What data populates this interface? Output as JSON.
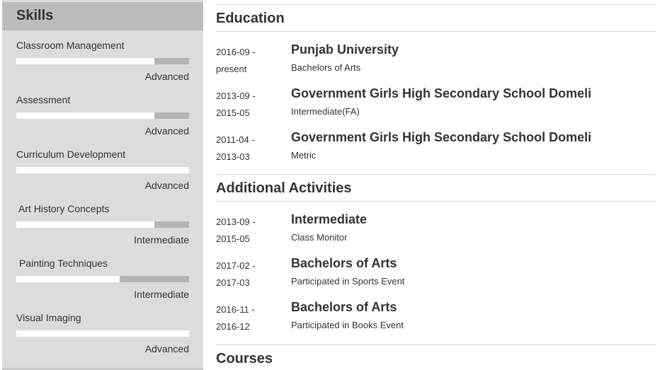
{
  "sidebar": {
    "title": "Skills",
    "skills": [
      {
        "name": "Classroom Management",
        "level": "Advanced",
        "fill": 0.8
      },
      {
        "name": "Assessment",
        "level": "Advanced",
        "fill": 0.8
      },
      {
        "name": "Curriculum Development",
        "level": "Advanced",
        "fill": 1.0
      },
      {
        "name": "Art History Concepts",
        "level": "Intermediate",
        "fill": 0.8
      },
      {
        "name": "Painting Techniques",
        "level": "Intermediate",
        "fill": 0.6
      },
      {
        "name": "Visual Imaging",
        "level": "Advanced",
        "fill": 1.0
      }
    ]
  },
  "education": {
    "title": "Education",
    "entries": [
      {
        "date_start": "2016-09 -",
        "date_end": "present",
        "title": "Punjab University",
        "subtitle": "Bachelors of Arts"
      },
      {
        "date_start": "2013-09 -",
        "date_end": "2015-05",
        "title": "Government Girls High Secondary School Domeli",
        "subtitle": "Intermediate(FA)"
      },
      {
        "date_start": "2011-04 -",
        "date_end": "2013-03",
        "title": "Government Girls High Secondary School Domeli",
        "subtitle": "Metric"
      }
    ]
  },
  "activities": {
    "title": "Additional Activities",
    "entries": [
      {
        "date_start": "2013-09 -",
        "date_end": "2015-05",
        "title": "Intermediate",
        "subtitle": "Class Monitor"
      },
      {
        "date_start": "2017-02 -",
        "date_end": "2017-03",
        "title": "Bachelors of Arts",
        "subtitle": "Participated in Sports Event"
      },
      {
        "date_start": "2016-11 -",
        "date_end": "2016-12",
        "title": "Bachelors of Arts",
        "subtitle": "Participated in Books Event"
      }
    ]
  },
  "courses": {
    "title": "Courses"
  }
}
